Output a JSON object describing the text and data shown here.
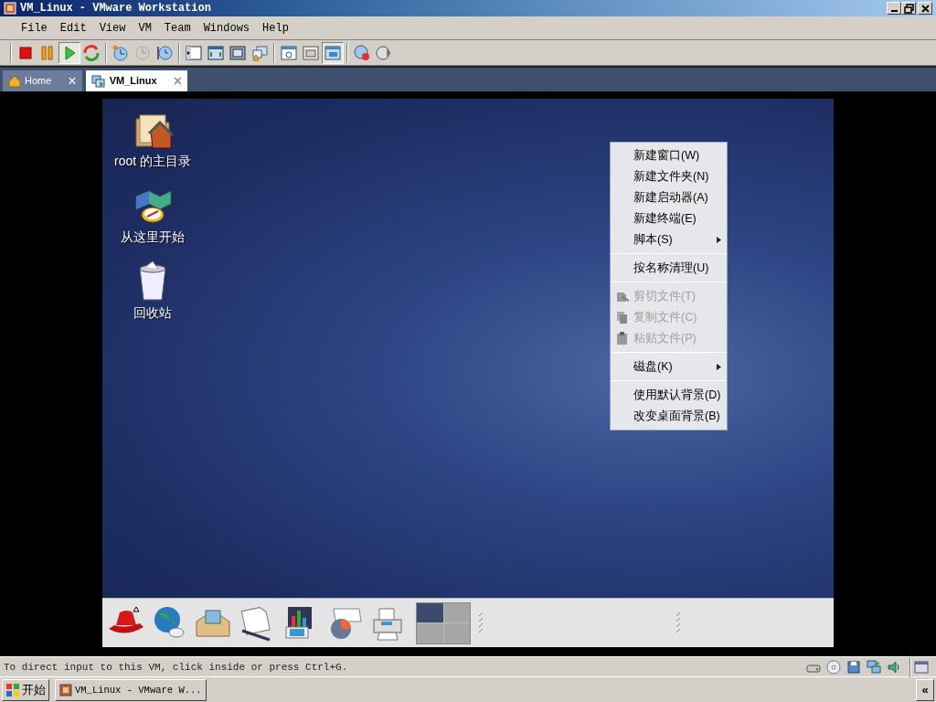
{
  "window": {
    "title": "VM_Linux - VMware Workstation"
  },
  "menu_bar": [
    "File",
    "Edit",
    "View",
    "VM",
    "Team",
    "Windows",
    "Help"
  ],
  "toolbar": [
    [
      {
        "pressed": false,
        "disabled": false
      },
      {
        "pressed": false,
        "disabled": false
      },
      {
        "pressed": true,
        "disabled": false
      },
      {
        "pressed": false,
        "disabled": false
      }
    ],
    [
      {
        "pressed": false,
        "disabled": false
      },
      {
        "pressed": false,
        "disabled": true
      },
      {
        "pressed": false,
        "disabled": false
      }
    ],
    [
      {
        "pressed": false,
        "disabled": false
      },
      {
        "pressed": false,
        "disabled": false
      },
      {
        "pressed": false,
        "disabled": false
      },
      {
        "pressed": false,
        "disabled": false
      }
    ],
    [
      {
        "pressed": false,
        "disabled": false
      },
      {
        "pressed": false,
        "disabled": false
      },
      {
        "pressed": true,
        "disabled": false
      }
    ],
    [
      {
        "pressed": false,
        "disabled": false
      },
      {
        "pressed": false,
        "disabled": false
      }
    ]
  ],
  "tabs": [
    {
      "label": "Home",
      "selected": false,
      "close": "×"
    },
    {
      "label": "VM_Linux",
      "selected": true,
      "close": "×"
    }
  ],
  "desktop": {
    "icons": [
      {
        "label": "root 的主目录"
      },
      {
        "label": "从这里开始"
      },
      {
        "label": "回收站"
      }
    ]
  },
  "context_menu": [
    {
      "kind": "item",
      "label": "新建窗口(W)",
      "disabled": false,
      "submenu": false,
      "icon": false
    },
    {
      "kind": "item",
      "label": "新建文件夹(N)",
      "disabled": false,
      "submenu": false,
      "icon": false
    },
    {
      "kind": "item",
      "label": "新建启动器(A)",
      "disabled": false,
      "submenu": false,
      "icon": false
    },
    {
      "kind": "item",
      "label": "新建终端(E)",
      "disabled": false,
      "submenu": false,
      "icon": false
    },
    {
      "kind": "item",
      "label": "脚本(S)",
      "disabled": false,
      "submenu": true,
      "icon": false
    },
    {
      "kind": "separator"
    },
    {
      "kind": "item",
      "label": "按名称清理(U)",
      "disabled": false,
      "submenu": false,
      "icon": false
    },
    {
      "kind": "separator"
    },
    {
      "kind": "item",
      "label": "剪切文件(T)",
      "disabled": true,
      "submenu": false,
      "icon": true
    },
    {
      "kind": "item",
      "label": "复制文件(C)",
      "disabled": true,
      "submenu": false,
      "icon": true
    },
    {
      "kind": "item",
      "label": "粘贴文件(P)",
      "disabled": true,
      "submenu": false,
      "icon": true
    },
    {
      "kind": "separator"
    },
    {
      "kind": "item",
      "label": "磁盘(K)",
      "disabled": false,
      "submenu": true,
      "icon": false
    },
    {
      "kind": "separator"
    },
    {
      "kind": "item",
      "label": "使用默认背景(D)",
      "disabled": false,
      "submenu": false,
      "icon": false
    },
    {
      "kind": "item",
      "label": "改变桌面背景(B)",
      "disabled": false,
      "submenu": false,
      "icon": false
    }
  ],
  "panel": {
    "workspaces": [
      {
        "selected": true
      },
      {
        "selected": false
      },
      {
        "selected": false
      },
      {
        "selected": false
      }
    ]
  },
  "status_bar": {
    "text": "To direct input to this VM, click inside or press Ctrl+G."
  },
  "taskbar": {
    "start": "开始",
    "tasks": [
      {
        "label": "VM_Linux - VMware W..."
      }
    ],
    "collapse": "«"
  }
}
